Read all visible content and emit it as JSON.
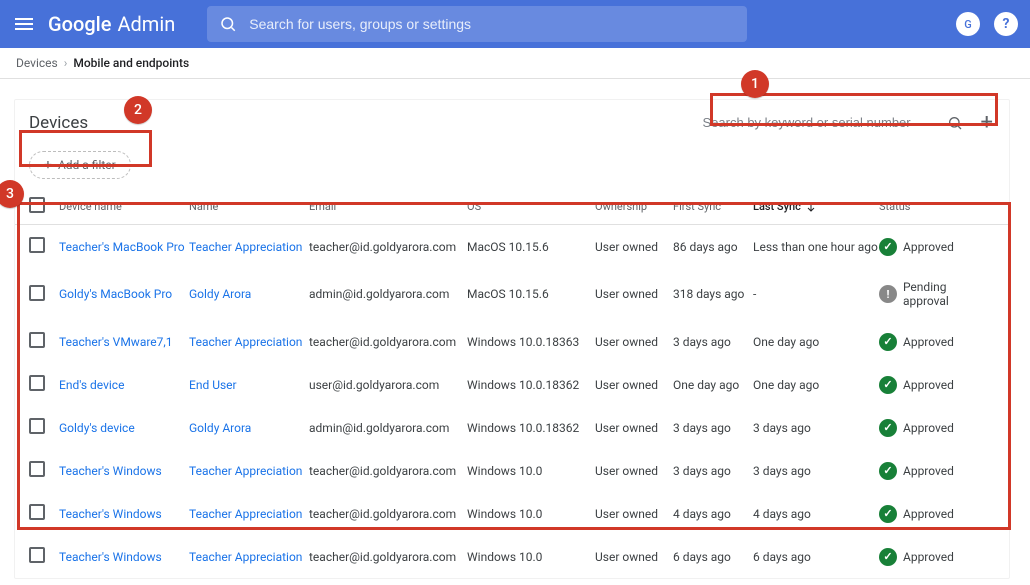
{
  "header": {
    "logo_primary": "Google",
    "logo_secondary": "Admin",
    "search_placeholder": "Search for users, groups or settings",
    "avatar_letter": "G"
  },
  "breadcrumb": {
    "parent": "Devices",
    "current": "Mobile and endpoints"
  },
  "page": {
    "title": "Devices",
    "keyword_placeholder": "Search by keyword or serial number",
    "add_filter_label": "Add a filter"
  },
  "columns": {
    "device_name": "Device name",
    "name": "Name",
    "email": "Email",
    "os": "OS",
    "ownership": "Ownership",
    "first_sync": "First Sync",
    "last_sync": "Last Sync",
    "status": "Status"
  },
  "sort": {
    "column": "last_sync",
    "direction": "desc"
  },
  "annotations": {
    "a1": "1",
    "a2": "2",
    "a3": "3"
  },
  "rows": [
    {
      "device_name": "Teacher's MacBook Pro",
      "name": "Teacher Appreciation",
      "email": "teacher@id.goldyarora.com",
      "os": "MacOS 10.15.6",
      "ownership": "User owned",
      "first_sync": "86 days ago",
      "last_sync": "Less than one hour ago",
      "status": "Approved",
      "status_type": "ok"
    },
    {
      "device_name": "Goldy's MacBook Pro",
      "name": "Goldy Arora",
      "email": "admin@id.goldyarora.com",
      "os": "MacOS 10.15.6",
      "ownership": "User owned",
      "first_sync": "318 days ago",
      "last_sync": "-",
      "status": "Pending approval",
      "status_type": "pending"
    },
    {
      "device_name": "Teacher's VMware7,1",
      "name": "Teacher Appreciation",
      "email": "teacher@id.goldyarora.com",
      "os": "Windows 10.0.18363",
      "ownership": "User owned",
      "first_sync": "3 days ago",
      "last_sync": "One day ago",
      "status": "Approved",
      "status_type": "ok"
    },
    {
      "device_name": "End's device",
      "name": "End User",
      "email": "user@id.goldyarora.com",
      "os": "Windows 10.0.18362",
      "ownership": "User owned",
      "first_sync": "One day ago",
      "last_sync": "One day ago",
      "status": "Approved",
      "status_type": "ok"
    },
    {
      "device_name": "Goldy's device",
      "name": "Goldy Arora",
      "email": "admin@id.goldyarora.com",
      "os": "Windows 10.0.18362",
      "ownership": "User owned",
      "first_sync": "3 days ago",
      "last_sync": "3 days ago",
      "status": "Approved",
      "status_type": "ok"
    },
    {
      "device_name": "Teacher's Windows",
      "name": "Teacher Appreciation",
      "email": "teacher@id.goldyarora.com",
      "os": "Windows 10.0",
      "ownership": "User owned",
      "first_sync": "3 days ago",
      "last_sync": "3 days ago",
      "status": "Approved",
      "status_type": "ok"
    },
    {
      "device_name": "Teacher's Windows",
      "name": "Teacher Appreciation",
      "email": "teacher@id.goldyarora.com",
      "os": "Windows 10.0",
      "ownership": "User owned",
      "first_sync": "4 days ago",
      "last_sync": "4 days ago",
      "status": "Approved",
      "status_type": "ok"
    },
    {
      "device_name": "Teacher's Windows",
      "name": "Teacher Appreciation",
      "email": "teacher@id.goldyarora.com",
      "os": "Windows 10.0",
      "ownership": "User owned",
      "first_sync": "6 days ago",
      "last_sync": "6 days ago",
      "status": "Approved",
      "status_type": "ok"
    }
  ]
}
